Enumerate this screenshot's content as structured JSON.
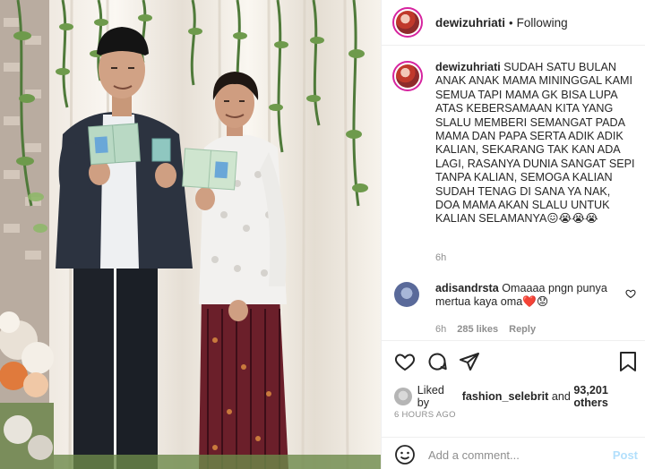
{
  "post": {
    "username": "dewizuhriati",
    "separator": "•",
    "follow_status": "Following"
  },
  "caption": {
    "username": "dewizuhriati",
    "text": "SUDAH SATU BULAN ANAK ANAK MAMA MININGGAL KAMI SEMUA TAPI MAMA GK BISA LUPA ATAS KEBERSAMAAN KITA YANG SLALU MEMBERI SEMANGAT PADA MAMA DAN PAPA SERTA ADIK ADIK KALIAN, SEKARANG TAK KAN ADA LAGI, RASANYA DUNIA SANGAT SEPI TANPA KALIAN, SEMOGA KALIAN SUDAH TENAG DI SANA YA NAK, DOA MAMA AKAN SLALU UNTUK KALIAN SELAMANYA",
    "emojis": "😖😭😭😭",
    "time": "6h"
  },
  "comment": {
    "username": "adisandrsta",
    "text": "Omaaaa pngn punya mertua kaya oma",
    "emojis": "❤️😟",
    "time": "6h",
    "likes": "285 likes",
    "reply": "Reply"
  },
  "likes": {
    "prefix": "Liked by",
    "user": "fashion_selebrit",
    "conj": "and",
    "count": "93,201 others"
  },
  "timestamp": "6 HOURS AGO",
  "add_comment": {
    "placeholder": "Add a comment...",
    "post_label": "Post"
  },
  "icons": {
    "like": "heart-icon",
    "comment": "comment-icon",
    "share": "paper-plane-icon",
    "save": "bookmark-icon",
    "emoji": "smiley-icon"
  },
  "colors": {
    "text": "#262626",
    "muted": "#8e8e8e",
    "post_disabled": "#b2dffc",
    "heart_red": "#ed4956"
  }
}
